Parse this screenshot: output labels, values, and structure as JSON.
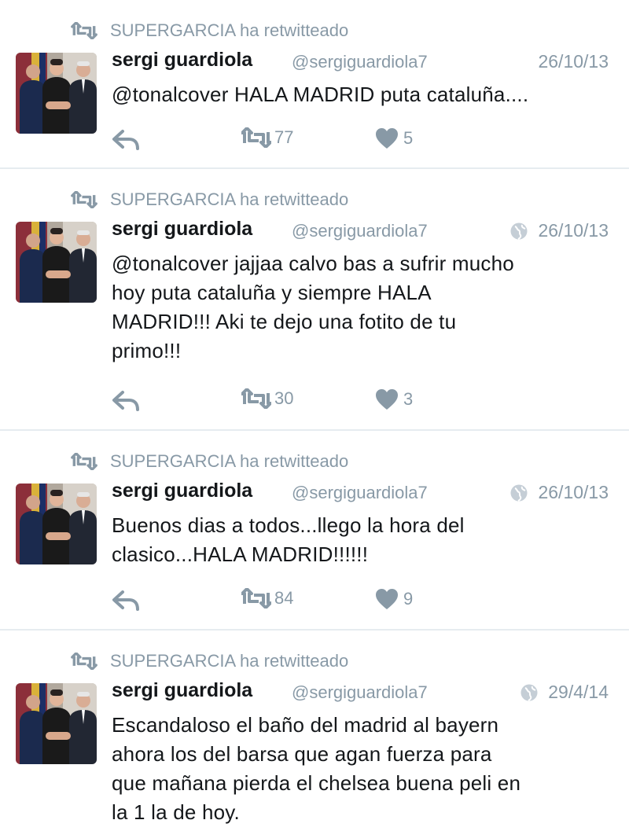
{
  "colors": {
    "text": "#14171a",
    "muted": "#8899a6",
    "divider": "#e6ecf0"
  },
  "tweets": [
    {
      "retweeted_by": "SUPERGARCIA ha retwitteado",
      "name": "sergi guardiola",
      "handle": "@sergiguardiola7",
      "date": "26/10/13",
      "globe": false,
      "lines": [
        "@tonalcover HALA MADRID puta cataluña...."
      ],
      "retweets": "77",
      "likes": "5"
    },
    {
      "retweeted_by": "SUPERGARCIA ha retwitteado",
      "name": "sergi guardiola",
      "handle": "@sergiguardiola7",
      "date": "26/10/13",
      "globe": true,
      "lines": [
        "@tonalcover jajjaa calvo bas a sufrir mucho",
        "hoy puta cataluña y siempre HALA",
        "MADRID!!! Aki te dejo una fotito de tu",
        "primo!!!"
      ],
      "retweets": "30",
      "likes": "3"
    },
    {
      "retweeted_by": "SUPERGARCIA ha retwitteado",
      "name": "sergi guardiola",
      "handle": "@sergiguardiola7",
      "date": "26/10/13",
      "globe": true,
      "lines": [
        "Buenos dias a todos...llego la hora del",
        "clasico...HALA MADRID!!!!!!"
      ],
      "retweets": "84",
      "likes": "9"
    },
    {
      "retweeted_by": "SUPERGARCIA ha retwitteado",
      "name": "sergi guardiola",
      "handle": "@sergiguardiola7",
      "date": "29/4/14",
      "globe": true,
      "lines": [
        "Escandaloso el baño del madrid al bayern",
        "ahora los del barsa que agan fuerza para",
        "que mañana pierda el chelsea buena peli en",
        "la 1 la de hoy."
      ]
    }
  ]
}
